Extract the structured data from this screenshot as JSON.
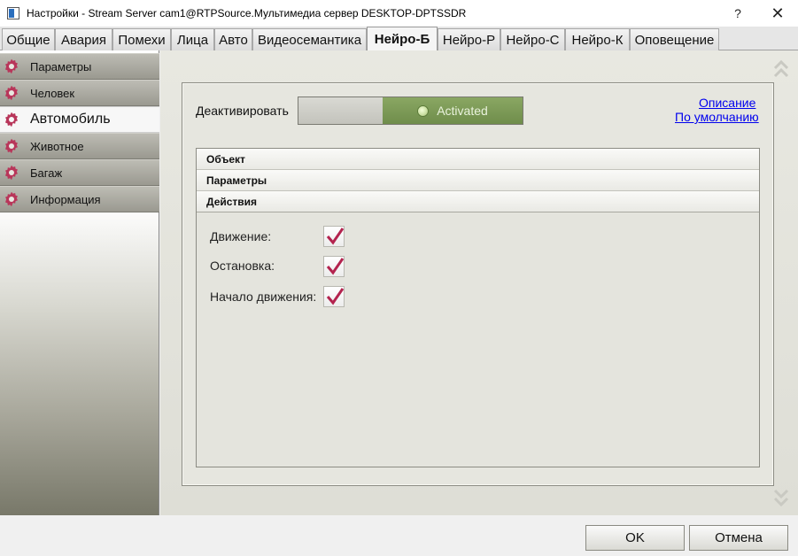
{
  "window": {
    "title": "Настройки - Stream Server cam1@RTPSource.Мультимедиа сервер DESKTOP-DPTSSDR",
    "help_label": "?",
    "close_label": "✕"
  },
  "tabs": [
    {
      "label": "Общие",
      "active": false
    },
    {
      "label": "Авария",
      "active": false
    },
    {
      "label": "Помехи",
      "active": false
    },
    {
      "label": "Лица",
      "active": false
    },
    {
      "label": "Авто",
      "active": false
    },
    {
      "label": "Видеосемантика",
      "active": false
    },
    {
      "label": "Нейро-Б",
      "active": true
    },
    {
      "label": "Нейро-Р",
      "active": false
    },
    {
      "label": "Нейро-С",
      "active": false
    },
    {
      "label": "Нейро-К",
      "active": false
    },
    {
      "label": "Оповещение",
      "active": false
    }
  ],
  "sidebar": {
    "items": [
      {
        "label": "Параметры",
        "active": false
      },
      {
        "label": "Человек",
        "active": false
      },
      {
        "label": "Автомобиль",
        "active": true
      },
      {
        "label": "Животное",
        "active": false
      },
      {
        "label": "Багаж",
        "active": false
      },
      {
        "label": "Информация",
        "active": false
      }
    ],
    "gear_color": "#b8365a"
  },
  "panel": {
    "deactivate_label": "Деактивировать",
    "toggle_state_label": "Activated",
    "toggle_on_color": "#7f9b58",
    "description_link": "Описание",
    "default_link": "По умолчанию",
    "sections": [
      {
        "title": "Объект"
      },
      {
        "title": "Параметры"
      },
      {
        "title": "Действия"
      }
    ],
    "actions": [
      {
        "label": "Движение:",
        "checked": true
      },
      {
        "label": "Остановка:",
        "checked": true
      },
      {
        "label": "Начало движения:",
        "checked": true
      }
    ],
    "check_color": "#b3234e"
  },
  "footer": {
    "ok_label": "OK",
    "cancel_label": "Отмена"
  }
}
